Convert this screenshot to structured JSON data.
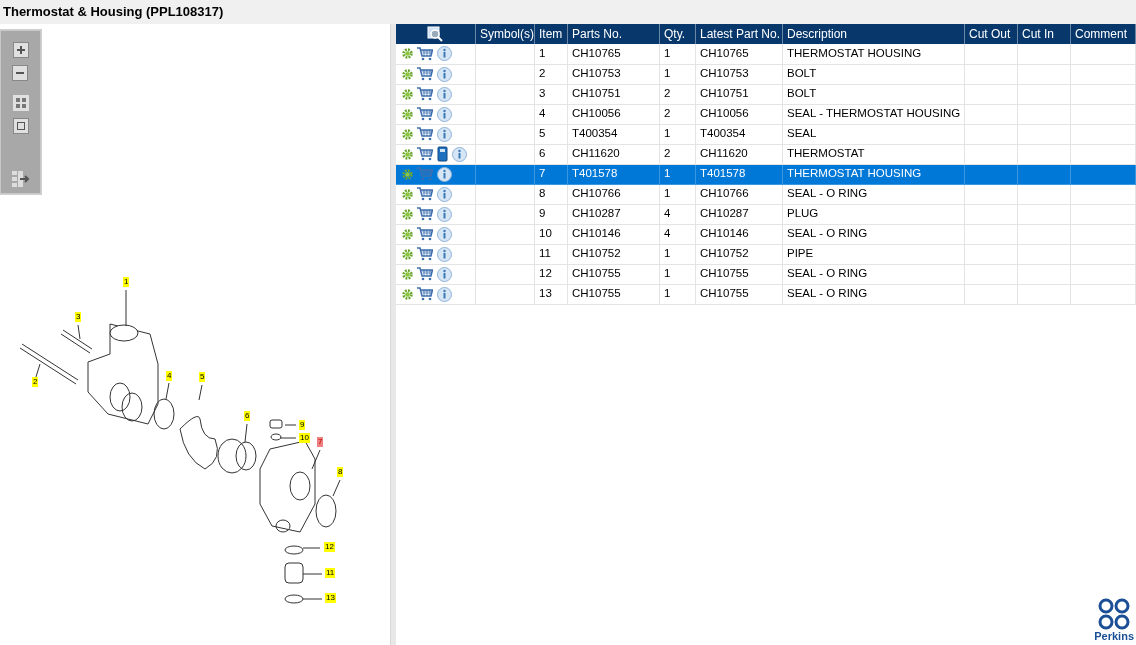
{
  "window": {
    "title": "Thermostat & Housing (PPL108317)"
  },
  "diagram": {
    "callouts": [
      {
        "label": "1",
        "selected": false
      },
      {
        "label": "3",
        "selected": false
      },
      {
        "label": "2",
        "selected": false
      },
      {
        "label": "4",
        "selected": false
      },
      {
        "label": "5",
        "selected": false
      },
      {
        "label": "6",
        "selected": false
      },
      {
        "label": "9",
        "selected": false
      },
      {
        "label": "10",
        "selected": false
      },
      {
        "label": "7",
        "selected": true
      },
      {
        "label": "8",
        "selected": false
      },
      {
        "label": "12",
        "selected": false
      },
      {
        "label": "11",
        "selected": false
      },
      {
        "label": "13",
        "selected": false
      }
    ]
  },
  "table": {
    "columns": [
      "Symbol(s)",
      "Item",
      "Parts No.",
      "Qty.",
      "Latest Part No.",
      "Description",
      "Cut Out",
      "Cut In",
      "Comment"
    ],
    "rows": [
      {
        "book": false,
        "selected": false,
        "cells": [
          "",
          "1",
          "CH10765",
          "1",
          "CH10765",
          "THERMOSTAT HOUSING",
          "",
          "",
          ""
        ]
      },
      {
        "book": false,
        "selected": false,
        "cells": [
          "",
          "2",
          "CH10753",
          "1",
          "CH10753",
          "BOLT",
          "",
          "",
          ""
        ]
      },
      {
        "book": false,
        "selected": false,
        "cells": [
          "",
          "3",
          "CH10751",
          "2",
          "CH10751",
          "BOLT",
          "",
          "",
          ""
        ]
      },
      {
        "book": false,
        "selected": false,
        "cells": [
          "",
          "4",
          "CH10056",
          "2",
          "CH10056",
          "SEAL - THERMOSTAT HOUSING",
          "",
          "",
          ""
        ]
      },
      {
        "book": false,
        "selected": false,
        "cells": [
          "",
          "5",
          "T400354",
          "1",
          "T400354",
          "SEAL",
          "",
          "",
          ""
        ]
      },
      {
        "book": true,
        "selected": false,
        "cells": [
          "",
          "6",
          "CH11620",
          "2",
          "CH11620",
          "THERMOSTAT",
          "",
          "",
          ""
        ]
      },
      {
        "book": false,
        "selected": true,
        "cells": [
          "",
          "7",
          "T401578",
          "1",
          "T401578",
          "THERMOSTAT HOUSING",
          "",
          "",
          ""
        ]
      },
      {
        "book": false,
        "selected": false,
        "cells": [
          "",
          "8",
          "CH10766",
          "1",
          "CH10766",
          "SEAL - O RING",
          "",
          "",
          ""
        ]
      },
      {
        "book": false,
        "selected": false,
        "cells": [
          "",
          "9",
          "CH10287",
          "4",
          "CH10287",
          "PLUG",
          "",
          "",
          ""
        ]
      },
      {
        "book": false,
        "selected": false,
        "cells": [
          "",
          "10",
          "CH10146",
          "4",
          "CH10146",
          "SEAL - O RING",
          "",
          "",
          ""
        ]
      },
      {
        "book": false,
        "selected": false,
        "cells": [
          "",
          "11",
          "CH10752",
          "1",
          "CH10752",
          "PIPE",
          "",
          "",
          ""
        ]
      },
      {
        "book": false,
        "selected": false,
        "cells": [
          "",
          "12",
          "CH10755",
          "1",
          "CH10755",
          "SEAL - O RING",
          "",
          "",
          ""
        ]
      },
      {
        "book": false,
        "selected": false,
        "cells": [
          "",
          "13",
          "CH10755",
          "1",
          "CH10755",
          "SEAL - O RING",
          "",
          "",
          ""
        ]
      }
    ]
  },
  "brand": {
    "name": "Perkins"
  }
}
